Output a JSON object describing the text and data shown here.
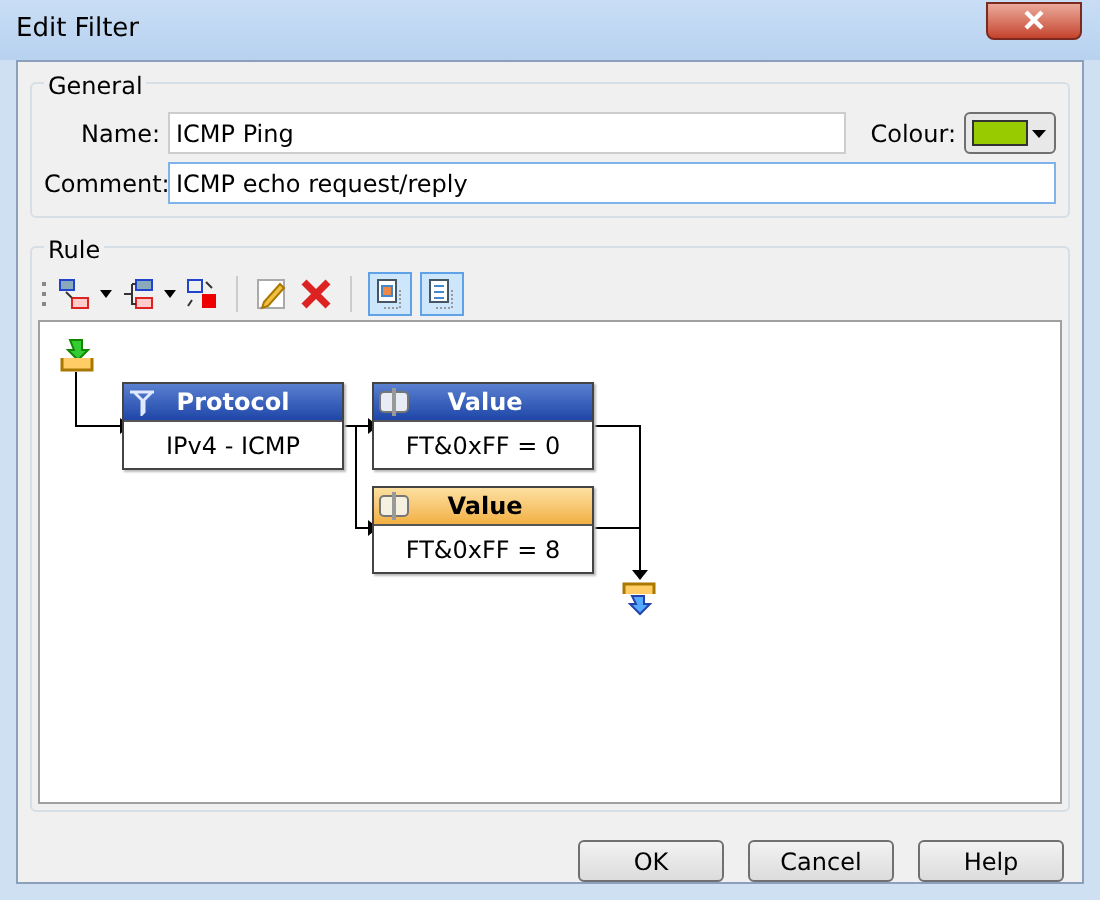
{
  "window": {
    "title": "Edit Filter"
  },
  "general": {
    "title": "General",
    "name_label": "Name:",
    "name_value": "ICMP Ping",
    "colour_label": "Colour:",
    "color": "#99cc00",
    "comment_label": "Comment:",
    "comment_value": "ICMP echo request/reply"
  },
  "rule": {
    "title": "Rule",
    "view_toggles": [
      {
        "on": true
      },
      {
        "on": true
      }
    ],
    "nodes": [
      {
        "kind": "protocol",
        "title": "Protocol",
        "body": "IPv4 - ICMP",
        "selected": false
      },
      {
        "kind": "value",
        "title": "Value",
        "body": "FT&0xFF = 0",
        "selected": false
      },
      {
        "kind": "value",
        "title": "Value",
        "body": "FT&0xFF = 8",
        "selected": true
      }
    ]
  },
  "buttons": [
    "OK",
    "Cancel",
    "Help"
  ]
}
